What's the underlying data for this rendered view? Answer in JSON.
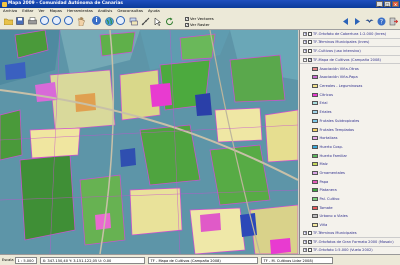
{
  "window": {
    "title": "Mapa 2009 - Comunidad Autónoma de Canarias",
    "minimize": "_",
    "maximize": "□",
    "close": "×"
  },
  "menu": [
    "Archivo",
    "Editar",
    "Ver",
    "Mapas",
    "Herramientas",
    "Análisis",
    "Geoconsultas",
    "Ayuda"
  ],
  "toolbar": {
    "checks": [
      {
        "label": "Ver Vectores",
        "checked": true
      },
      {
        "label": "Ver Raster",
        "checked": true
      }
    ]
  },
  "layers": {
    "groups": [
      {
        "label": "TF-Ortofoto de Cobertura 1:2.000 (Inres)"
      },
      {
        "label": "TF-Términos Municipales (Inres)"
      },
      {
        "label": "TF-Cultivos (uso intensivo)"
      }
    ],
    "main_layer": "TF-Mapa de Cultivos (Campaña 2008)",
    "legend": [
      {
        "label": "Asociación Viña-Otros",
        "color": "#e68a8a"
      },
      {
        "label": "Asociación Viña-Papa",
        "color": "#c76fd0"
      },
      {
        "label": "Cereales - Leguminosas",
        "color": "#f2e28c"
      },
      {
        "label": "Cítricos",
        "color": "#e83bd0"
      },
      {
        "label": "Erial",
        "color": "#a8dede"
      },
      {
        "label": "Eriales",
        "color": "#9fd4e8"
      },
      {
        "label": "Frutales Subtropicales",
        "color": "#7dc9e8"
      },
      {
        "label": "Frutales Templados",
        "color": "#f4d36a"
      },
      {
        "label": "Hortalizas",
        "color": "#e8a8e8"
      },
      {
        "label": "Huerto Cosp.",
        "color": "#3aa8d8"
      },
      {
        "label": "Huerto Familiar",
        "color": "#5fb85f"
      },
      {
        "label": "Maíz",
        "color": "#c4d85a"
      },
      {
        "label": "Ornamentales",
        "color": "#d9a6e6"
      },
      {
        "label": "Papa",
        "color": "#e65ab8"
      },
      {
        "label": "Platanera",
        "color": "#3fa83f"
      },
      {
        "label": "Pal. Cultivo",
        "color": "#7cd17c"
      },
      {
        "label": "Tomate",
        "color": "#e85a5a"
      },
      {
        "label": "Urbano o Viales",
        "color": "#bcbcbc"
      },
      {
        "label": "Viña",
        "color": "#f3e8a0"
      }
    ],
    "bottom_groups": [
      {
        "label": "TF-Términos Municipales"
      },
      {
        "label": "TF-Ortofotos de Gran Formato 2000 (Mosaic)"
      },
      {
        "label": "TF-Ortofoto 1:5.000 (Vuelo 2002)"
      }
    ]
  },
  "status": {
    "scale_label": "Escala",
    "scale_value": "1 : 5.000",
    "coords": "X: 347.150,40   Y: 3.151.122,05  U: 0.00",
    "layer_info": "TF - Mapa de Cultivos (Campaña 2008)",
    "extra": "TF - M. Cultivos Lidar 2008)"
  }
}
